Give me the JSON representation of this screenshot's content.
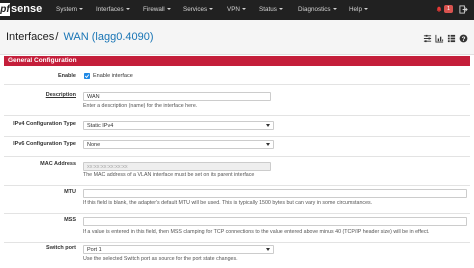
{
  "nav": {
    "logo": "sense",
    "logo_mark": "pf",
    "items": [
      {
        "label": "System"
      },
      {
        "label": "Interfaces"
      },
      {
        "label": "Firewall"
      },
      {
        "label": "Services"
      },
      {
        "label": "VPN"
      },
      {
        "label": "Status"
      },
      {
        "label": "Diagnostics"
      },
      {
        "label": "Help"
      }
    ],
    "notification_count": "1",
    "icons": [
      "bell-icon",
      "logout-icon"
    ]
  },
  "header": {
    "breadcrumb_root": "Interfaces",
    "separator": "/",
    "breadcrumb_current": "WAN (lagg0.4090)",
    "icons": [
      "sliders-icon",
      "chart-icon",
      "list-icon",
      "help-icon"
    ]
  },
  "panel": {
    "title": "General Configuration",
    "enable": {
      "label": "Enable",
      "checkbox_label": "Enable interface",
      "checked": true
    },
    "description": {
      "label": "Description",
      "value": "WAN",
      "help": "Enter a description (name) for the interface here."
    },
    "ipv4": {
      "label": "IPv4 Configuration Type",
      "value": "Static IPv4"
    },
    "ipv6": {
      "label": "IPv6 Configuration Type",
      "value": "None"
    },
    "mac": {
      "label": "MAC Address",
      "placeholder": "xx:xx:xx:xx:xx:xx",
      "help": "The MAC address of a VLAN interface must be set on its parent interface"
    },
    "mtu": {
      "label": "MTU",
      "value": "",
      "help": "If this field is blank, the adapter's default MTU will be used. This is typically 1500 bytes but can vary in some circumstances."
    },
    "mss": {
      "label": "MSS",
      "value": "",
      "help": "If a value is entered in this field, then MSS clamping for TCP connections to the value entered above minus 40 (TCP/IP header size) will be in effect."
    },
    "switch_port": {
      "label": "Switch port",
      "value": "Port 1",
      "help": "Use the selected Switch port as source for the port state changes."
    }
  },
  "colors": {
    "navbar": "#212121",
    "accent": "#c41e3a",
    "link": "#1975b5",
    "checkbox": "#1e88e5",
    "badge": "#d9534f"
  }
}
